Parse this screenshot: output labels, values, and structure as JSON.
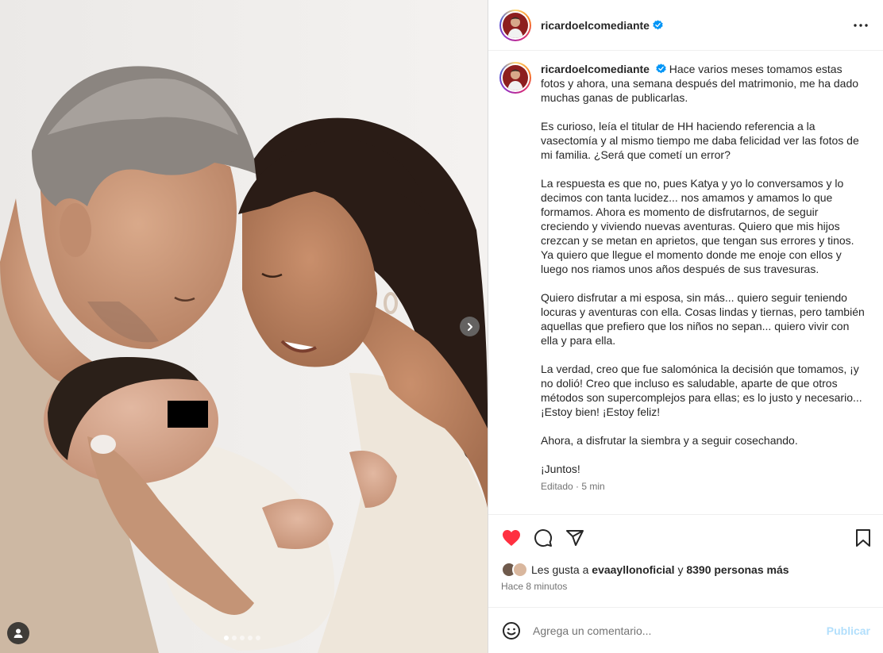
{
  "post": {
    "username": "ricardoelcomediante",
    "caption_first": "Hace varios meses tomamos estas fotos y ahora, una semana después del matrimonio, me ha dado muchas ganas de publicarlas.",
    "paragraphs": [
      "Es curioso, leía el titular de HH haciendo referencia a la vasectomía y al mismo tiempo me daba felicidad ver las fotos de mi familia. ¿Será que cometí un error?",
      "La respuesta es que no, pues Katya y yo lo conversamos y lo decimos con tanta lucidez... nos amamos y amamos lo que formamos. Ahora es momento de disfrutarnos, de seguir creciendo y viviendo nuevas aventuras. Quiero que mis hijos crezcan y se metan en aprietos, que tengan sus errores y tinos. Ya quiero que llegue el momento donde me enoje con ellos y luego nos riamos unos años después de sus travesuras.",
      "Quiero disfrutar a mi esposa, sin más... quiero seguir teniendo locuras y aventuras con ella. Cosas lindas y tiernas, pero también aquellas que prefiero que los niños no sepan... quiero vivir con ella y para ella.",
      "La verdad, creo que fue salomónica la decisión que tomamos, ¡y no dolió! Creo que incluso es saludable, aparte de que otros métodos son supercomplejos para ellas; es lo justo y necesario... ¡Estoy bien! ¡Estoy feliz!",
      "Ahora, a disfrutar la siembra y a seguir cosechando.",
      "¡Juntos!"
    ],
    "meta": "Editado · 5 min"
  },
  "likes": {
    "prefix": "Les gusta a ",
    "user": "evaayllonoficial",
    "middle": " y ",
    "count": "8390 personas más"
  },
  "time_ago": "Hace 8 minutos",
  "comment": {
    "placeholder": "Agrega un comentario...",
    "publish": "Publicar"
  },
  "carousel": {
    "total": 5,
    "active": 0
  },
  "icons": {
    "verified": "verified-badge-icon",
    "more": "more-options-icon",
    "like": "heart-icon",
    "comment": "comment-icon",
    "share": "share-icon",
    "save": "bookmark-icon",
    "emoji": "emoji-icon",
    "next": "chevron-right-icon",
    "tags": "user-tag-icon"
  },
  "colors": {
    "like_red": "#ff3040",
    "verified_blue": "#0095f6",
    "publish_disabled": "#b2dffc"
  }
}
